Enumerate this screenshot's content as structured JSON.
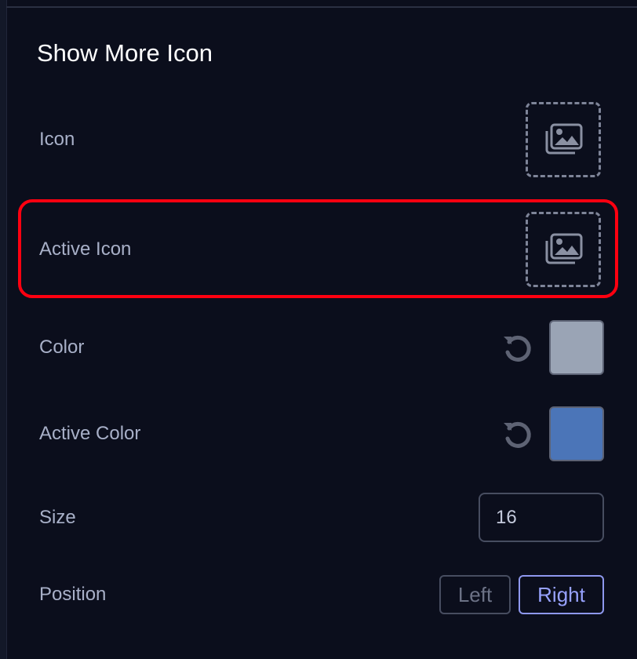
{
  "section": {
    "title": "Show More Icon"
  },
  "rows": {
    "icon": {
      "label": "Icon",
      "picker_icon": "image-gallery-icon"
    },
    "active_icon": {
      "label": "Active Icon",
      "picker_icon": "image-gallery-icon"
    },
    "color": {
      "label": "Color",
      "value": "#9aa4b5",
      "reset_icon": "reset-icon"
    },
    "active_color": {
      "label": "Active Color",
      "value": "#4b75b8",
      "reset_icon": "reset-icon"
    },
    "size": {
      "label": "Size",
      "value": "16"
    },
    "position": {
      "label": "Position",
      "options": [
        "Left",
        "Right"
      ],
      "selected": "Right"
    }
  },
  "highlight_color": "#ff0010"
}
